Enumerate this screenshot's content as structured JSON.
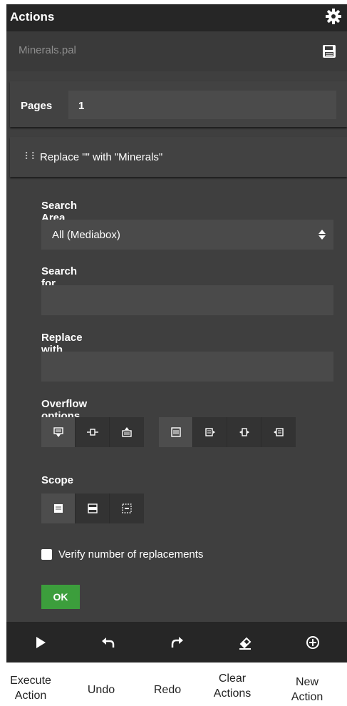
{
  "header": {
    "title": "Actions",
    "settings_icon": "gear-icon"
  },
  "file": {
    "name": "Minerals.pal",
    "save_icon": "floppy-disk-icon"
  },
  "pages": {
    "label": "Pages",
    "value": "1"
  },
  "action": {
    "drag_icon": "drag-handle-icon",
    "label": "Replace \"\" with \"Minerals\""
  },
  "form": {
    "search_area": {
      "label": "Search Area",
      "selected": "All (Mediabox)"
    },
    "search_for": {
      "label": "Search for",
      "value": ""
    },
    "replace_with": {
      "label": "Replace with",
      "value": ""
    },
    "overflow": {
      "label": "Overflow options"
    },
    "scope": {
      "label": "Scope"
    },
    "verify": {
      "label": "Verify number of replacements",
      "checked": false
    },
    "ok_label": "OK"
  },
  "toolbar": {
    "execute_icon": "play-icon",
    "undo_icon": "undo-icon",
    "redo_icon": "redo-icon",
    "clear_icon": "eraser-icon",
    "new_icon": "plus-circle-icon"
  },
  "labels": {
    "execute_1": "Execute",
    "execute_2": "Action",
    "undo": "Undo",
    "redo": "Redo",
    "clear_1": "Clear",
    "clear_2": "Actions",
    "new_1": "New",
    "new_2": "Action"
  },
  "colors": {
    "panel": "#3f3f3f",
    "header": "#262626",
    "ok_button": "#3c9e3c",
    "input": "#4a4a4a"
  }
}
